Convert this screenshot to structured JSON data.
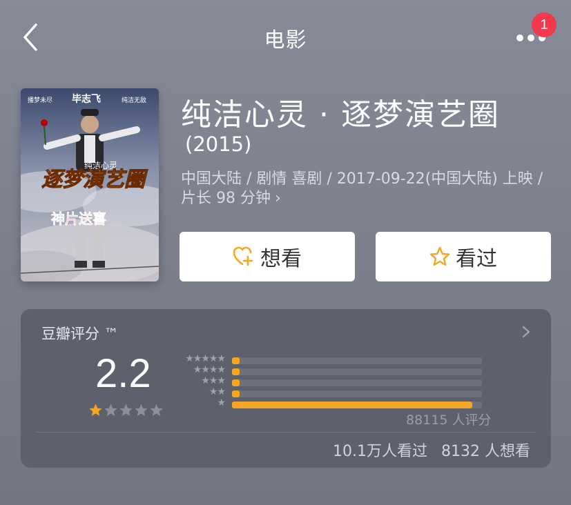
{
  "nav": {
    "title": "电影",
    "notification_count": "1"
  },
  "movie": {
    "title": "纯洁心灵 · 逐梦演艺圈",
    "year": "(2015)",
    "meta_line1": "中国大陆 / 剧情 喜剧 / 2017-09-22(中国大陆) 上映 /",
    "meta_line2": "片长 98 分钟",
    "poster": {
      "top_left": "播梦未尽",
      "top_center": "毕志飞",
      "top_right": "纯洁无敌",
      "small_title": "纯洁心灵",
      "big_title": "逐梦演艺圈",
      "tagline": "神片送喜"
    }
  },
  "actions": {
    "want_label": "想看",
    "seen_label": "看过"
  },
  "rating": {
    "header": "豆瓣评分 ™",
    "score": "2.2",
    "stars_filled": 1,
    "stars_total": 5,
    "distribution": [
      {
        "stars": "★★★★★",
        "fraction": 0.03
      },
      {
        "stars": "★★★★",
        "fraction": 0.03
      },
      {
        "stars": "★★★",
        "fraction": 0.03
      },
      {
        "stars": "★★",
        "fraction": 0.03
      },
      {
        "stars": "★",
        "fraction": 0.96
      }
    ],
    "count_text": "88115 人评分",
    "seen_text": "10.1万人看过",
    "want_text": "8132 人想看"
  },
  "colors": {
    "accent": "#f5a623",
    "badge": "#f2394e",
    "icon_orange": "#f5a623"
  }
}
